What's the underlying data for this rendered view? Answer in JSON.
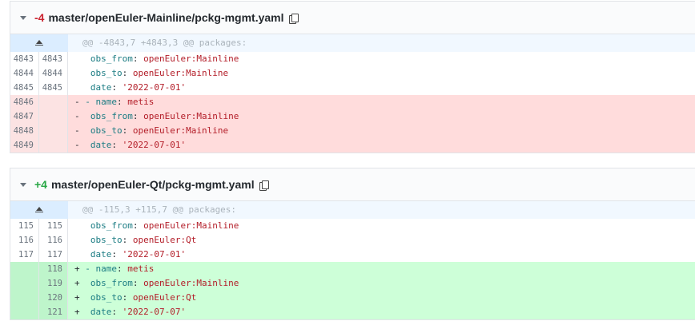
{
  "files": [
    {
      "count": "-4",
      "path": "master/openEuler-Mainline/pckg-mgmt.yaml",
      "hunk": "@@ -4843,7 +4843,3 @@ packages:",
      "rows": [
        {
          "old": "4843",
          "new": "4843",
          "marker": " ",
          "key": "obs_from",
          "value": "openEuler:Mainline",
          "indent": "  "
        },
        {
          "old": "4844",
          "new": "4844",
          "marker": " ",
          "key": "obs_to",
          "value": "openEuler:Mainline",
          "indent": "  "
        },
        {
          "old": "4845",
          "new": "4845",
          "marker": " ",
          "key": "date",
          "value": "'2022-07-01'",
          "indent": "  "
        },
        {
          "old": "4846",
          "new": "",
          "marker": "- ",
          "key": "- name",
          "value": "metis",
          "indent": ""
        },
        {
          "old": "4847",
          "new": "",
          "marker": "-",
          "key": "obs_from",
          "value": "openEuler:Mainline",
          "indent": "  "
        },
        {
          "old": "4848",
          "new": "",
          "marker": "-",
          "key": "obs_to",
          "value": "openEuler:Mainline",
          "indent": "  "
        },
        {
          "old": "4849",
          "new": "",
          "marker": "-",
          "key": "date",
          "value": "'2022-07-01'",
          "indent": "  "
        }
      ]
    },
    {
      "count": "+4",
      "path": "master/openEuler-Qt/pckg-mgmt.yaml",
      "hunk": "@@ -115,3 +115,7 @@ packages:",
      "rows": [
        {
          "old": "115",
          "new": "115",
          "marker": " ",
          "key": "obs_from",
          "value": "openEuler:Mainline",
          "indent": "  "
        },
        {
          "old": "116",
          "new": "116",
          "marker": " ",
          "key": "obs_to",
          "value": "openEuler:Qt",
          "indent": "  "
        },
        {
          "old": "117",
          "new": "117",
          "marker": " ",
          "key": "date",
          "value": "'2022-07-01'",
          "indent": "  "
        },
        {
          "old": "",
          "new": "118",
          "marker": "+ ",
          "key": "- name",
          "value": "metis",
          "indent": ""
        },
        {
          "old": "",
          "new": "119",
          "marker": "+",
          "key": "obs_from",
          "value": "openEuler:Mainline",
          "indent": "  "
        },
        {
          "old": "",
          "new": "120",
          "marker": "+",
          "key": "obs_to",
          "value": "openEuler:Qt",
          "indent": "  "
        },
        {
          "old": "",
          "new": "121",
          "marker": "+",
          "key": "date",
          "value": "'2022-07-07'",
          "indent": "  "
        }
      ]
    }
  ]
}
